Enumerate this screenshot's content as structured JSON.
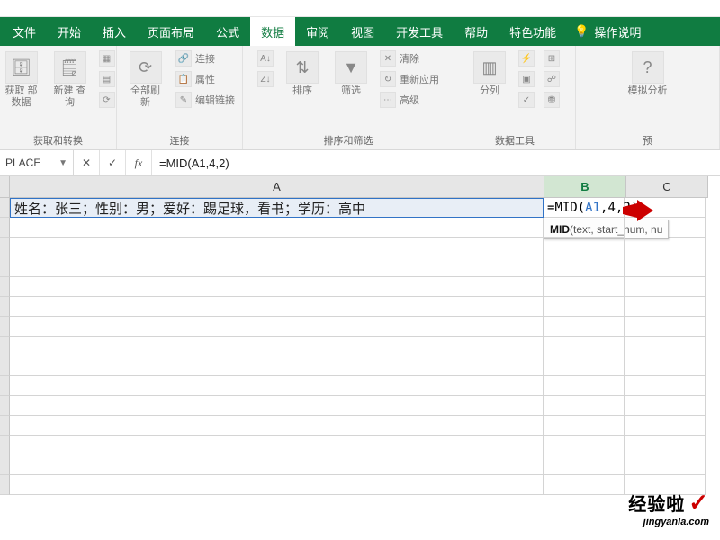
{
  "ribbon_tabs": {
    "file": "文件",
    "home": "开始",
    "insert": "插入",
    "page_layout": "页面布局",
    "formulas": "公式",
    "data": "数据",
    "review": "审阅",
    "view": "视图",
    "developer": "开发工具",
    "help": "帮助",
    "special": "特色功能",
    "tell_me": "操作说明"
  },
  "ribbon": {
    "get_transform": {
      "label": "获取和转换",
      "get_external": "获取\n部数据",
      "new_query": "新建\n查询"
    },
    "connections": {
      "label": "连接",
      "refresh_all": "全部刷新",
      "conn": "连接",
      "props": "属性",
      "edit_links": "编辑链接"
    },
    "sort_filter": {
      "label": "排序和筛选",
      "sort": "排序",
      "filter": "筛选",
      "clear": "清除",
      "reapply": "重新应用",
      "advanced": "高级"
    },
    "data_tools": {
      "label": "数据工具",
      "text_to_col": "分列"
    },
    "forecast": {
      "label": "预",
      "whatif": "模拟分析"
    }
  },
  "namebox": "PLACE",
  "formula": "=MID(A1,4,2)",
  "columns": {
    "A": "A",
    "B": "B",
    "C": "C"
  },
  "cellA1": "姓名：张三；性别：男；爱好：踢足球，看书；学历：高中",
  "b1_parts": {
    "eq": "=",
    "fn": "MID",
    "lp": "(",
    "ref": "A1",
    "c1": ",",
    "a2": "4",
    "c2": ",",
    "a3": "2",
    "rp": ")"
  },
  "tooltip": {
    "bold": "MID",
    "rest": "(text, start_num, nu"
  },
  "watermark": {
    "cn": "经验啦",
    "en": "jingyanla.com"
  }
}
